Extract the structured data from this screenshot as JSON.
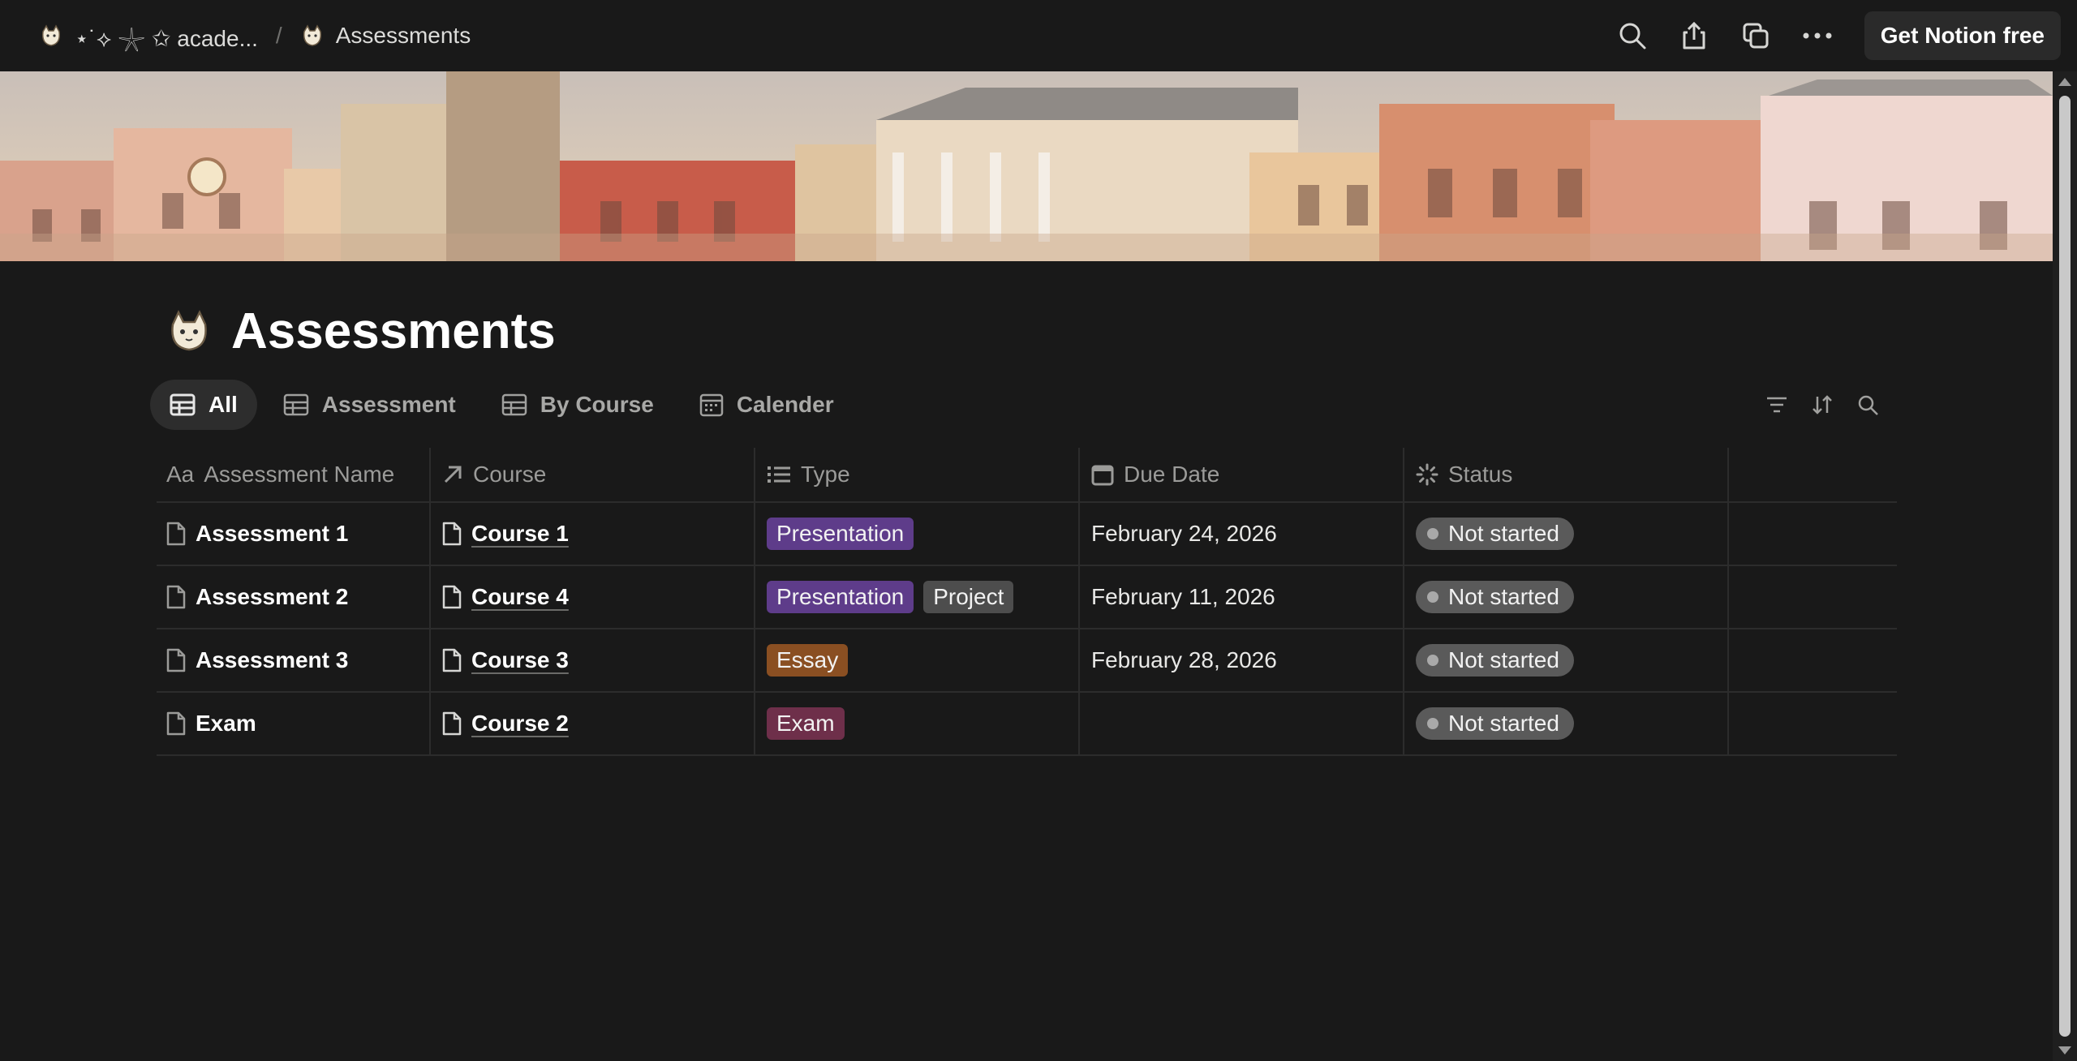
{
  "breadcrumb": {
    "workspace": "⋆˙⟡ 𓇼 ✩ acade...",
    "separator": "/",
    "page": "Assessments"
  },
  "topbar": {
    "icons": [
      "search-icon",
      "share-icon",
      "duplicate-icon",
      "more-icon"
    ],
    "cta_label": "Get Notion free"
  },
  "page": {
    "title": "Assessments"
  },
  "views": [
    {
      "label": "All",
      "icon": "table-icon",
      "active": true
    },
    {
      "label": "Assessment",
      "icon": "table-icon",
      "active": false
    },
    {
      "label": "By Course",
      "icon": "table-icon",
      "active": false
    },
    {
      "label": "Calender",
      "icon": "calendar-icon",
      "active": false
    }
  ],
  "table": {
    "columns": [
      {
        "label": "Assessment Name",
        "icon": "title-icon"
      },
      {
        "label": "Course",
        "icon": "relation-arrow-icon"
      },
      {
        "label": "Type",
        "icon": "multiselect-icon"
      },
      {
        "label": "Due Date",
        "icon": "calendar-icon"
      },
      {
        "label": "Status",
        "icon": "status-icon"
      }
    ],
    "rows": [
      {
        "name": "Assessment 1",
        "course": "Course 1",
        "types": [
          {
            "label": "Presentation",
            "color": "#5e3c8a"
          }
        ],
        "due": "February 24, 2026",
        "status": "Not started"
      },
      {
        "name": "Assessment 2",
        "course": "Course 4",
        "types": [
          {
            "label": "Presentation",
            "color": "#5e3c8a"
          },
          {
            "label": "Project",
            "color": "#4d4d4d"
          }
        ],
        "due": "February 11, 2026",
        "status": "Not started"
      },
      {
        "name": "Assessment 3",
        "course": "Course 3",
        "types": [
          {
            "label": "Essay",
            "color": "#8a4f22"
          }
        ],
        "due": "February 28, 2026",
        "status": "Not started"
      },
      {
        "name": "Exam",
        "course": "Course 2",
        "types": [
          {
            "label": "Exam",
            "color": "#6e2f4a"
          }
        ],
        "due": "",
        "status": "Not started"
      }
    ]
  },
  "colors": {
    "background": "#191919",
    "status_badge": "#5a5a5a",
    "presentation": "#5e3c8a",
    "project": "#4d4d4d",
    "essay": "#8a4f22",
    "exam": "#6e2f4a"
  }
}
